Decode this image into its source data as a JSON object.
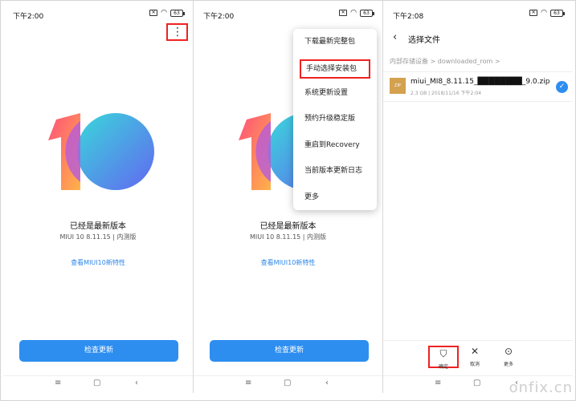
{
  "status": {
    "time_1": "下午2:00",
    "time_2": "下午2:00",
    "time_3": "下午2:08",
    "battery": "63"
  },
  "update_screen": {
    "status_title": "已经是最新版本",
    "version": "MIUI 10 8.11.15 | 内测版",
    "features_link": "查看MIUI10新特性",
    "check_button": "检查更新"
  },
  "menu": {
    "items": [
      {
        "label": "下载最新完整包"
      },
      {
        "label": "手动选择安装包"
      },
      {
        "label": "系统更新设置"
      },
      {
        "label": "预约升级稳定版"
      },
      {
        "label": "重启到Recovery"
      },
      {
        "label": "当前版本更新日志"
      },
      {
        "label": "更多"
      }
    ]
  },
  "file_picker": {
    "title": "选择文件",
    "breadcrumb": "内部存储设备 > downloaded_rom >",
    "file": {
      "name": "miui_MI8_8.11.15_████████_9.0.zip",
      "meta": "2.3 GB | 2018/11/16 下午2:04",
      "type": "ZIP"
    },
    "actions": {
      "confirm": "确定",
      "cancel": "取消",
      "more": "更多"
    }
  },
  "nav": {
    "menu": "≡",
    "home": "▢",
    "back": "‹"
  },
  "watermark": "onfix.cn",
  "colors": {
    "accent": "#2d8ef0",
    "highlight": "#e22222"
  }
}
